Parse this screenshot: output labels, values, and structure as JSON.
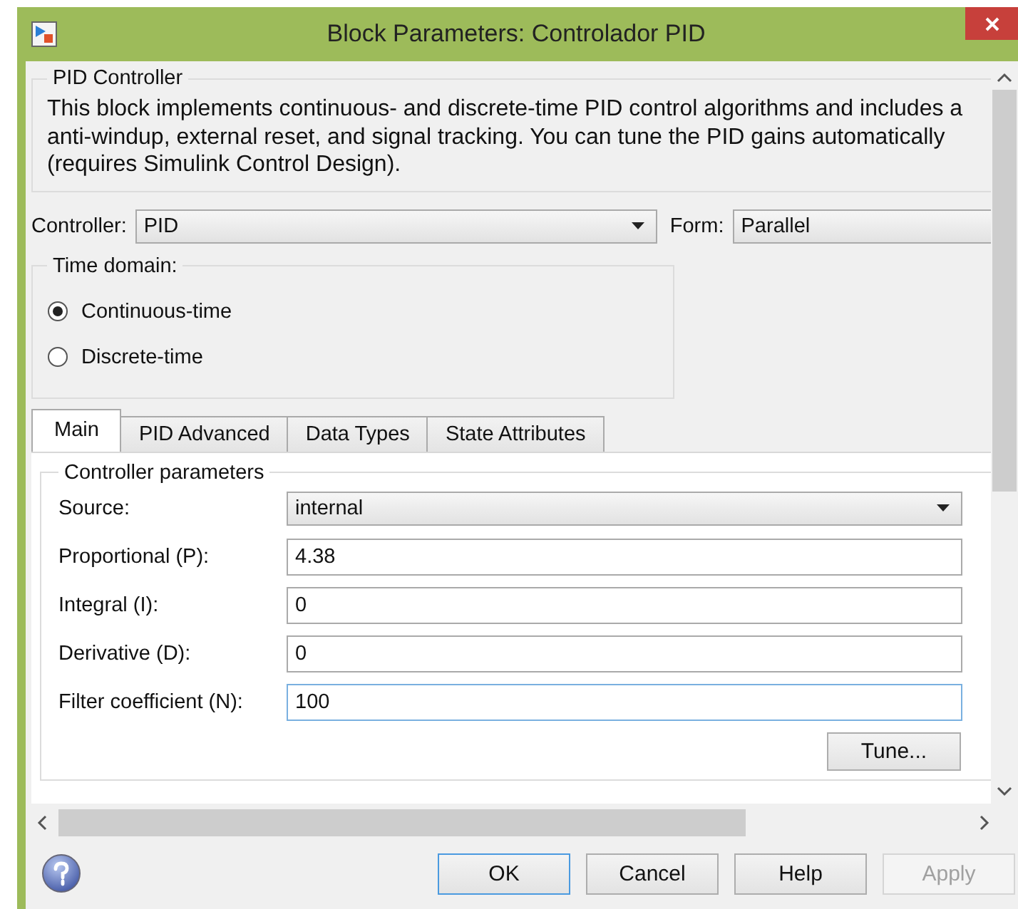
{
  "window": {
    "title": "Block Parameters: Controlador PID"
  },
  "description_group": {
    "title": "PID Controller",
    "text": "This block implements continuous- and discrete-time PID control algorithms and includes a\nanti-windup, external reset, and signal tracking. You can tune the PID gains automatically\n(requires Simulink Control Design)."
  },
  "controller": {
    "label": "Controller:",
    "value": "PID"
  },
  "form": {
    "label": "Form:",
    "value": "Parallel"
  },
  "time_domain": {
    "title": "Time domain:",
    "options": [
      {
        "label": "Continuous-time",
        "selected": true
      },
      {
        "label": "Discrete-time",
        "selected": false
      }
    ]
  },
  "tabs": [
    {
      "label": "Main",
      "selected": true
    },
    {
      "label": "PID Advanced",
      "selected": false
    },
    {
      "label": "Data Types",
      "selected": false
    },
    {
      "label": "State Attributes",
      "selected": false
    }
  ],
  "parameters": {
    "title": "Controller parameters",
    "fields": [
      {
        "kind": "dropdown",
        "label": "Source:",
        "value": "internal"
      },
      {
        "kind": "text",
        "label": "Proportional (P):",
        "value": "4.38",
        "focused": false
      },
      {
        "kind": "text",
        "label": "Integral (I):",
        "value": "0",
        "focused": false
      },
      {
        "kind": "text",
        "label": "Derivative (D):",
        "value": "0",
        "focused": false
      },
      {
        "kind": "text",
        "label": "Filter coefficient (N):",
        "value": "100",
        "focused": true
      }
    ]
  },
  "tune_button": "Tune...",
  "buttons": [
    {
      "label": "OK",
      "focused": true,
      "disabled": false
    },
    {
      "label": "Cancel",
      "focused": false,
      "disabled": false
    },
    {
      "label": "Help",
      "focused": false,
      "disabled": false
    },
    {
      "label": "Apply",
      "focused": false,
      "disabled": true
    }
  ]
}
